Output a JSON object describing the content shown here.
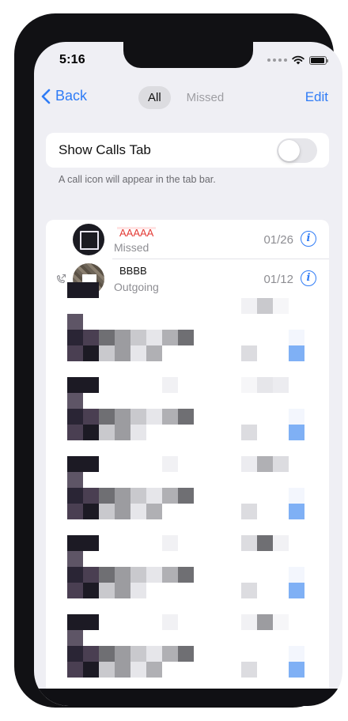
{
  "status": {
    "time": "5:16"
  },
  "nav": {
    "back_label": "Back",
    "tabs": [
      {
        "label": "All",
        "active": true
      },
      {
        "label": "Missed",
        "active": false
      }
    ],
    "edit_label": "Edit"
  },
  "settings": {
    "toggle_label": "Show Calls Tab",
    "toggle_on": false,
    "hint": "A call icon will appear in the tab bar."
  },
  "calls": [
    {
      "name": "AAAAA",
      "type": "Missed",
      "date": "01/26",
      "missed": true
    },
    {
      "name": "BBBB",
      "type": "Outgoing",
      "date": "01/12",
      "missed": false
    }
  ],
  "icons": {
    "back": "chevron-left-icon",
    "info": "info-circle-icon",
    "outgoing": "outgoing-call-icon",
    "wifi": "wifi-icon",
    "battery": "battery-icon"
  },
  "colors": {
    "accent": "#2f7cf6",
    "missed": "#e33b35",
    "background": "#efeff4"
  }
}
